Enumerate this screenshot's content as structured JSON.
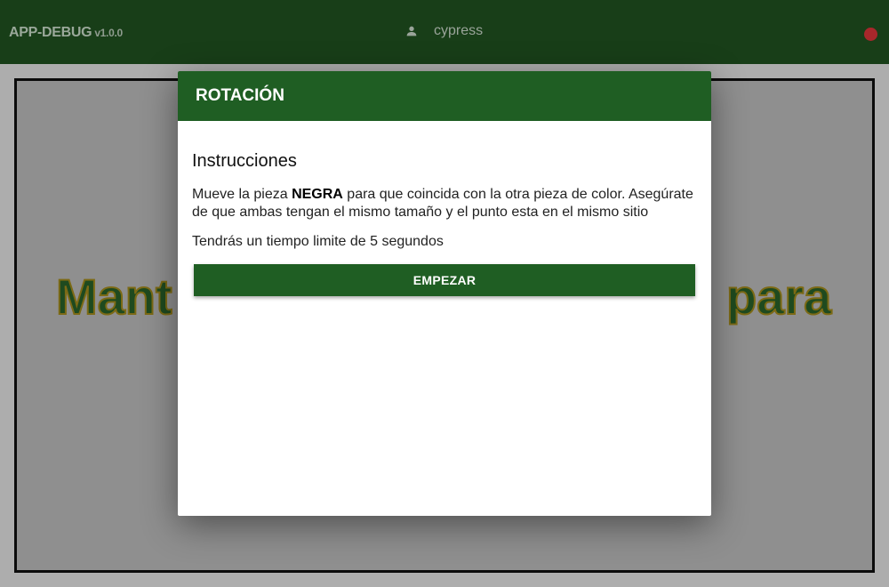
{
  "topbar": {
    "app_title": "APP-DEBUG",
    "app_version": "v1.0.0",
    "user_name": "cypress",
    "user_icon": "person-icon",
    "status_color": "#a8272b"
  },
  "stage": {
    "text_left": "Mant",
    "text_right": "para"
  },
  "modal": {
    "title": "ROTACIÓN",
    "instructions_title": "Instrucciones",
    "instructions_before": "Mueve la pieza ",
    "instructions_bold": "NEGRA",
    "instructions_after": " para que coincida con la otra pieza de color. Asegúrate de que ambas tengan el mismo tamaño y el punto esta en el mismo sitio",
    "time_text": "Tendrás un tiempo limite de 5 segundos",
    "start_label": "EMPEZAR"
  },
  "colors": {
    "topbar_bg": "#183e18",
    "accent": "#1f5e23"
  }
}
